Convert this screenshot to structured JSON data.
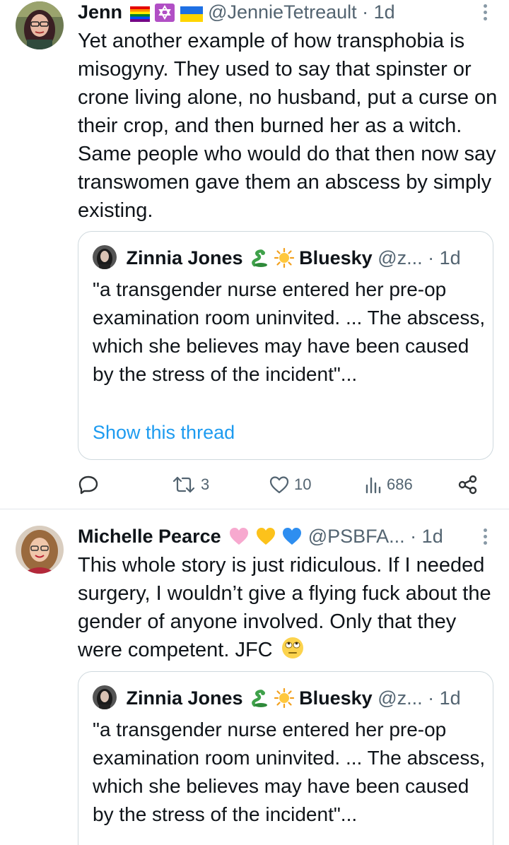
{
  "tweets": [
    {
      "author": {
        "name": "Jenn",
        "flags": [
          "rainbow-flag",
          "star-of-david-flag",
          "ukraine-flag"
        ],
        "handle": "@JennieTetreault",
        "time": "1d"
      },
      "text": "Yet another example of how transphobia is misogyny. They used to say that spinster or crone living alone, no husband, put a curse on their crop, and then burned her as a witch. Same people who would do that then now say transwomen gave them an abscess by simply existing.",
      "quote": {
        "name": "Zinnia Jones",
        "emoji": [
          "snake-emoji",
          "sun-emoji"
        ],
        "name_suffix": "Bluesky",
        "handle": "@z...",
        "time": "1d",
        "text": "\"a transgender nurse entered her pre-op examination room uninvited. ... The abscess, which she believes may have been caused by the stress of the incident\"...",
        "link": "Show this thread"
      },
      "actions": {
        "reply": "",
        "retweets": "3",
        "likes": "10",
        "views": "686"
      }
    },
    {
      "author": {
        "name": "Michelle Pearce",
        "hearts": [
          "pink-heart",
          "yellow-heart",
          "blue-heart"
        ],
        "handle": "@PSBFA...",
        "time": "1d"
      },
      "text": "This whole story is just ridiculous. If I needed surgery, I wouldn’t give a flying fuck about the gender of anyone involved. Only that they were competent. JFC",
      "text_emoji": "eye-roll-emoji",
      "quote": {
        "name": "Zinnia Jones",
        "emoji": [
          "snake-emoji",
          "sun-emoji"
        ],
        "name_suffix": "Bluesky",
        "handle": "@z...",
        "time": "1d",
        "text": "\"a transgender nurse entered her pre-op examination room uninvited. ... The abscess, which she believes may have been caused by the stress of the incident\"..."
      }
    }
  ],
  "separator": "·",
  "colors": {
    "link": "#1d9bf0",
    "secondary_text": "#536471",
    "border": "#cfd9de",
    "divider": "#e1e6ea"
  }
}
